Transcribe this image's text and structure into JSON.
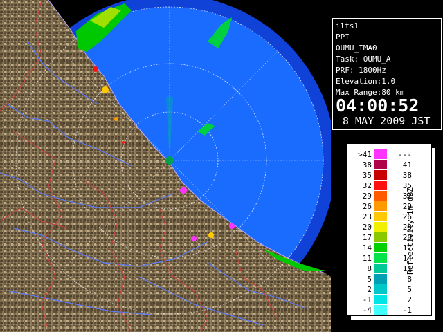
{
  "window": {
    "title": "ilts1"
  },
  "info": {
    "product": "PPI",
    "site": "OUMU_IMA0",
    "task_label": "Task:",
    "task_value": "OUMU_A",
    "prf_label": "PRF:",
    "prf_value": "1800Hz",
    "elevation_label": "Elevation:",
    "elevation_value": "1.0",
    "max_range_label": "Max Range:",
    "max_range_value": "80 km",
    "time": "04:00:52",
    "date": "8 MAY 2009 JST"
  },
  "legend": {
    "unit_label": "Reflectivity in dBZ",
    "rows": [
      {
        "low": ">41",
        "high": "---",
        "color": "#ff33ff"
      },
      {
        "low": "38",
        "high": "41",
        "color": "#b0004a"
      },
      {
        "low": "35",
        "high": "38",
        "color": "#c80000"
      },
      {
        "low": "32",
        "high": "35",
        "color": "#ff1010"
      },
      {
        "low": "29",
        "high": "32",
        "color": "#ff5a00"
      },
      {
        "low": "26",
        "high": "29",
        "color": "#ff9a00"
      },
      {
        "low": "23",
        "high": "26",
        "color": "#ffc800"
      },
      {
        "low": "20",
        "high": "23",
        "color": "#f0f000"
      },
      {
        "low": "17",
        "high": "20",
        "color": "#8ac800"
      },
      {
        "low": "14",
        "high": "17",
        "color": "#00d000"
      },
      {
        "low": "11",
        "high": "14",
        "color": "#00e44a"
      },
      {
        "low": "8",
        "high": "11",
        "color": "#00c896"
      },
      {
        "low": "5",
        "high": "8",
        "color": "#00a0b4"
      },
      {
        "low": "2",
        "high": "5",
        "color": "#00c8c8"
      },
      {
        "low": "-1",
        "high": "2",
        "color": "#00e6e6"
      },
      {
        "low": "-4",
        "high": "-1",
        "color": "#40ffff"
      }
    ]
  },
  "map": {
    "sea_color": "#1a6cff",
    "outer_ring_color": "#1040e0",
    "land_color": "#7a6a4e"
  }
}
